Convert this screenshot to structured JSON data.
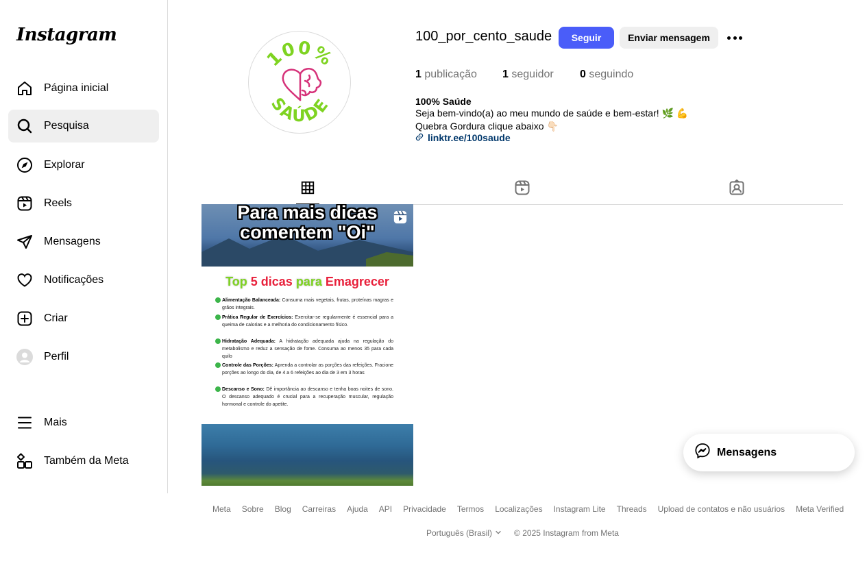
{
  "app": {
    "logo": "Instagram"
  },
  "sidebar": {
    "items": [
      {
        "label": "Página inicial",
        "icon": "home-icon"
      },
      {
        "label": "Pesquisa",
        "icon": "search-icon",
        "active": true
      },
      {
        "label": "Explorar",
        "icon": "compass-icon"
      },
      {
        "label": "Reels",
        "icon": "reels-icon"
      },
      {
        "label": "Mensagens",
        "icon": "send-icon"
      },
      {
        "label": "Notificações",
        "icon": "heart-icon"
      },
      {
        "label": "Criar",
        "icon": "plus-square-icon"
      },
      {
        "label": "Perfil",
        "icon": "avatar-icon"
      }
    ],
    "more": {
      "label": "Mais",
      "icon": "menu-icon"
    },
    "meta": {
      "label": "Também da Meta",
      "icon": "meta-grid-icon"
    }
  },
  "profile": {
    "avatar_text_top": "100%",
    "avatar_text_bottom": "SAÚDE",
    "username": "100_por_cento_saude",
    "follow_label": "Seguir",
    "message_label": "Enviar mensagem",
    "stats": {
      "posts_count": "1",
      "posts_label": "publicação",
      "followers_count": "1",
      "followers_label": "seguidor",
      "following_count": "0",
      "following_label": "seguindo"
    },
    "bio_name": "100% Saúde",
    "bio_line1": "Seja bem-vindo(a) ao meu mundo de saúde e bem-estar! 🌿 💪",
    "bio_line2": "Quebra Gordura clique abaixo 👇🏻",
    "link": "linktr.ee/100saude"
  },
  "tabs": [
    {
      "icon": "grid-icon",
      "active": true
    },
    {
      "icon": "reels-icon",
      "active": false
    },
    {
      "icon": "tagged-icon",
      "active": false
    }
  ],
  "post": {
    "caption_line1": "Para mais dicas",
    "caption_line2": "comentem \"Oi\"",
    "title_part1": "Top",
    "title_part2": "5 dicas",
    "title_part3": "para",
    "title_part4": "Emagrecer",
    "tips": [
      {
        "head": "Alimentação Balanceada:",
        "body": "Consuma mais vegetais, frutas, proteínas magras e grãos integrais."
      },
      {
        "head": "Prática Regular de Exercícios:",
        "body": "Exercitar-se regularmente é essencial para a queima de calorias e a melhoria do condicionamento físico."
      },
      {
        "head": "Hidratação Adequada:",
        "body": "A hidratação adequada ajuda na regulação do metabolismo e reduz a sensação de fome. Consuma ao menos 35 para cada quilo"
      },
      {
        "head": "Controle das Porções:",
        "body": "Aprenda a controlar as porções das refeições. Fracione porções ao longo do dia, de 4 a 6 refeições ao dia de 3 em 3 horas"
      },
      {
        "head": "Descanso e Sono:",
        "body": "Dê importância ao descanso e tenha boas noites de sono. O descanso adequado é crucial para a recuperação muscular, regulação hormonal e controle do apetite."
      }
    ]
  },
  "footer": {
    "links": [
      "Meta",
      "Sobre",
      "Blog",
      "Carreiras",
      "Ajuda",
      "API",
      "Privacidade",
      "Termos",
      "Localizações",
      "Instagram Lite",
      "Threads",
      "Upload de contatos e não usuários",
      "Meta Verified"
    ],
    "language": "Português (Brasil)",
    "copyright": "© 2025 Instagram from Meta"
  },
  "messages_pill": {
    "label": "Mensagens",
    "icon": "messenger-icon"
  },
  "colors": {
    "accent": "#4a5df9",
    "link": "#00376b",
    "muted": "#737373",
    "border": "#dbdbdb",
    "brand_green": "#7ed321",
    "brand_pink": "#d6337a"
  }
}
